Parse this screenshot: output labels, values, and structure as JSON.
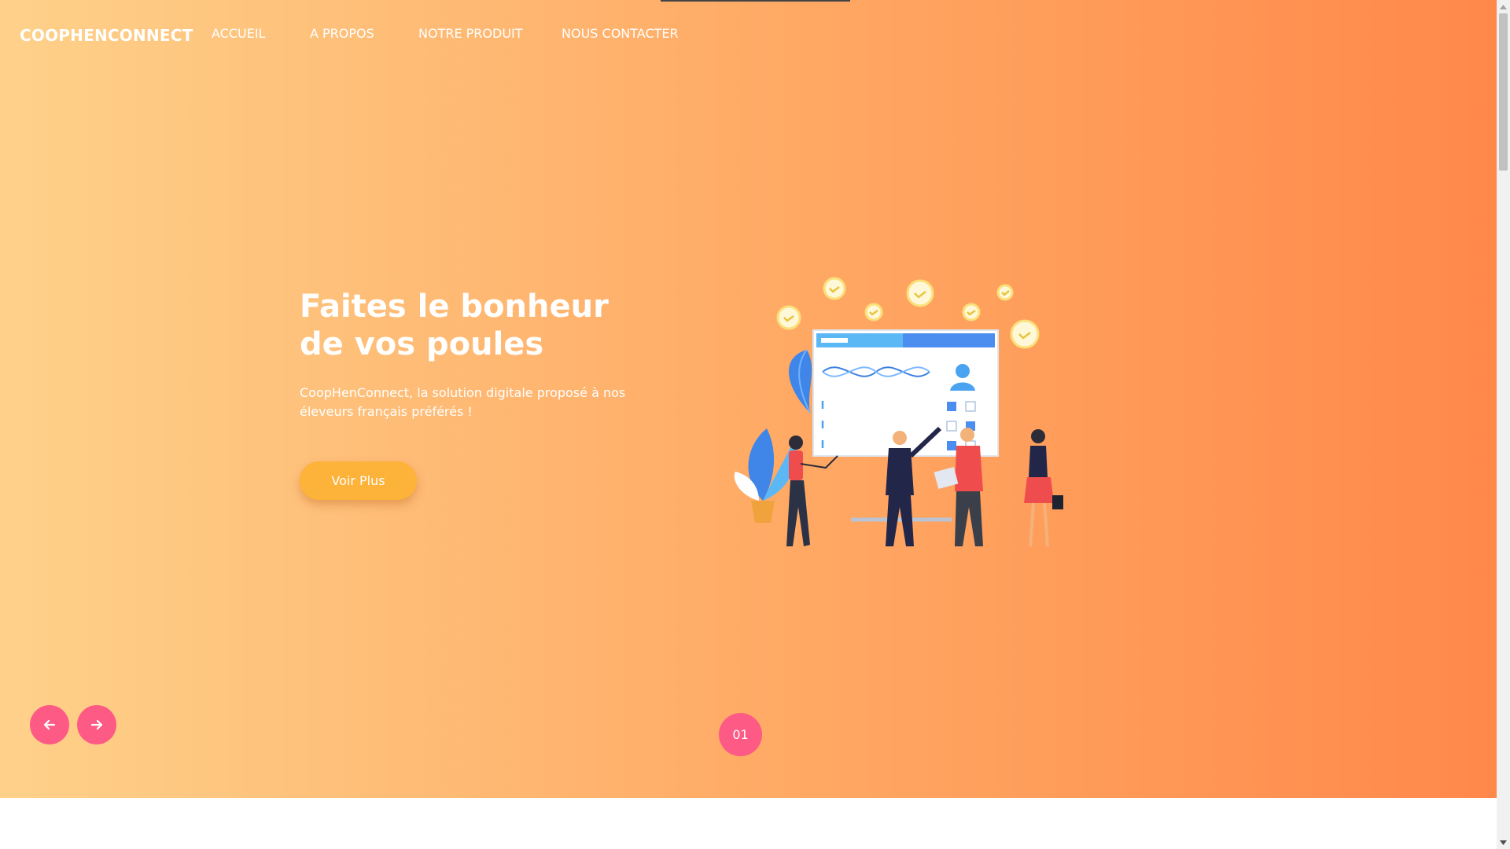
{
  "nav": {
    "brand": "COOPHENCONNECT",
    "links": [
      "ACCUEIL",
      "A PROPOS",
      "NOTRE PRODUIT",
      "NOUS CONTACTER"
    ]
  },
  "hero": {
    "title_line1": "Faites le bonheur",
    "title_line2": "de vos poules",
    "subtitle": "CoopHenConnect, la solution digitale proposé à nos éleveurs français préférés !",
    "cta_label": "Voir Plus"
  },
  "slider": {
    "prev_icon": "arrow-left-icon",
    "next_icon": "arrow-right-icon",
    "current_slide": "01"
  },
  "colors": {
    "gradient_start": "#fed18a",
    "gradient_end": "#ff884a",
    "accent_pink": "#fd5a85",
    "cta_orange": "#fdb23a"
  }
}
